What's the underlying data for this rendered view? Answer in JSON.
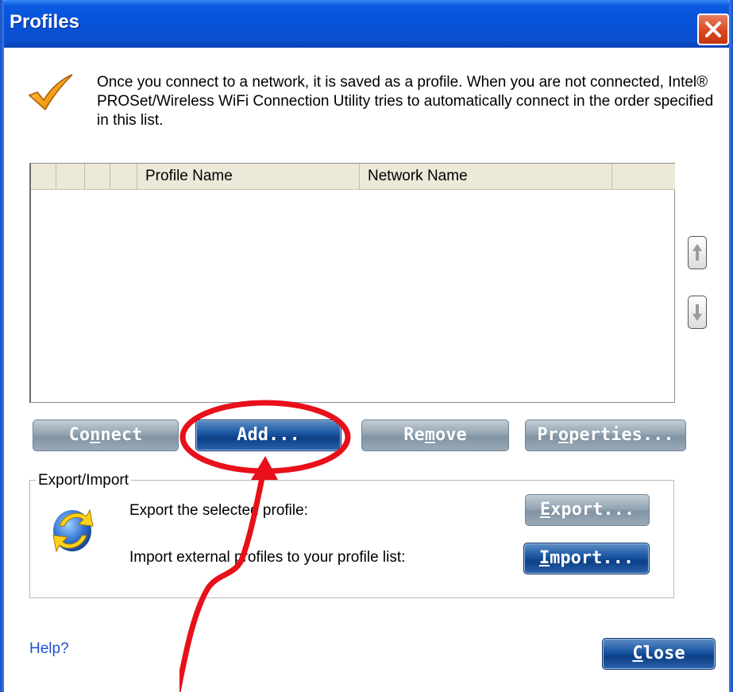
{
  "window": {
    "title": "Profiles",
    "close_icon": "close-x-icon"
  },
  "intro": {
    "icon": "checkmark-icon",
    "text": "Once you connect to a network, it is saved as a profile. When you are not connected, Intel® PROSet/Wireless WiFi Connection Utility tries to automatically connect in the order specified in this list."
  },
  "profile_list": {
    "columns": [
      "",
      "",
      "",
      "",
      "Profile Name",
      "Network Name",
      ""
    ],
    "rows": []
  },
  "reorder": {
    "up_icon": "arrow-up-icon",
    "down_icon": "arrow-down-icon"
  },
  "actions": {
    "connect_pre": "Co",
    "connect_mn": "n",
    "connect_post": "nect",
    "add": "Add...",
    "remove_pre": "Re",
    "remove_mn": "m",
    "remove_post": "ove",
    "properties_pre": "Pr",
    "properties_mn": "o",
    "properties_post": "perties..."
  },
  "export_import": {
    "legend": "Export/Import",
    "icon": "export-import-arrows-icon",
    "export_text": "Export the selected profile:",
    "import_text": "Import external profiles to your profile list:",
    "export_mn": "E",
    "export_post": "xport...",
    "import_mn": "I",
    "import_post": "mport..."
  },
  "footer": {
    "help": "Help?",
    "close_mn": "C",
    "close_post": "lose"
  },
  "annotation": {
    "color": "#e8101a"
  }
}
